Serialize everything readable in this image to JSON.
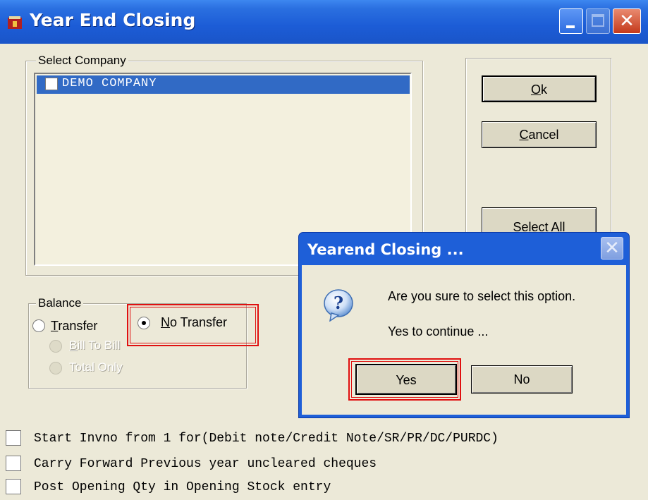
{
  "window": {
    "title": "Year End Closing",
    "close_glyph": "✕"
  },
  "select_company": {
    "legend": "Select Company",
    "items": [
      "DEMO COMPANY"
    ]
  },
  "buttons": {
    "ok_u": "O",
    "ok_rest": "k",
    "cancel_u": "C",
    "cancel_rest": "ancel",
    "select_all": "Select All"
  },
  "balance": {
    "legend": "Balance",
    "transfer_u": "T",
    "transfer_rest": "ransfer",
    "no_transfer_u": "N",
    "no_transfer_rest": "o Transfer",
    "bill_to_bill_u": "B",
    "bill_to_bill_rest": "ill To Bill",
    "total_only": "Total Only",
    "selected": "No Transfer"
  },
  "options": [
    "Start Invno from 1 for(Debit note/Credit Note/SR/PR/DC/PURDC)",
    "Carry Forward Previous year uncleared cheques",
    "Post Opening Qty in Opening Stock entry"
  ],
  "dialog": {
    "title": "Yearend Closing ...",
    "close_glyph": "✕",
    "message": "Are you sure to select this option.",
    "sub_message": "Yes to continue ...",
    "yes_label": "Yes",
    "no_label": "No",
    "icon": "question-icon"
  },
  "colors": {
    "titlebar": "#1c5cd6",
    "selection": "#316ac5",
    "highlight_box": "#e01010",
    "face": "#ece9d8"
  }
}
